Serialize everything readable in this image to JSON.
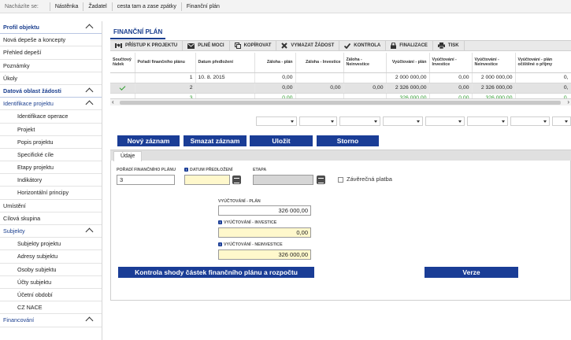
{
  "breadcrumb": {
    "label": "Nacházíte se:",
    "items": [
      "Nástěnka",
      "Žadatel",
      "cesta tam a zase zpátky",
      "Finanční plán"
    ]
  },
  "sidebar": {
    "items": [
      {
        "label": "Profil objektu",
        "kind": "sec",
        "chev": "up"
      },
      {
        "label": "Nová depeše a koncepty",
        "kind": "item"
      },
      {
        "label": "Přehled depeší",
        "kind": "item"
      },
      {
        "label": "Poznámky",
        "kind": "item"
      },
      {
        "label": "Úkoly",
        "kind": "item"
      },
      {
        "label": "Datová oblast žádosti",
        "kind": "sec",
        "chev": "up"
      },
      {
        "label": "Identifikace projektu",
        "kind": "blue",
        "chev": "up"
      },
      {
        "label": "Identifikace operace",
        "kind": "sub"
      },
      {
        "label": "Projekt",
        "kind": "sub"
      },
      {
        "label": "Popis projektu",
        "kind": "sub"
      },
      {
        "label": "Specifické cíle",
        "kind": "sub"
      },
      {
        "label": "Etapy projektu",
        "kind": "sub"
      },
      {
        "label": "Indikátory",
        "kind": "sub"
      },
      {
        "label": "Horizontální principy",
        "kind": "sub"
      },
      {
        "label": "Umístění",
        "kind": "item"
      },
      {
        "label": "Cílová skupina",
        "kind": "item"
      },
      {
        "label": "Subjekty",
        "kind": "blue",
        "chev": "up"
      },
      {
        "label": "Subjekty projektu",
        "kind": "sub"
      },
      {
        "label": "Adresy subjektu",
        "kind": "sub"
      },
      {
        "label": "Osoby subjektu",
        "kind": "sub"
      },
      {
        "label": "Účty subjektu",
        "kind": "sub"
      },
      {
        "label": "Účetní období",
        "kind": "sub"
      },
      {
        "label": "CZ NACE",
        "kind": "sub"
      },
      {
        "label": "Financování",
        "kind": "blue",
        "chev": "up"
      }
    ]
  },
  "page": {
    "title": "FINANČNÍ PLÁN"
  },
  "toolbar": [
    {
      "label": "PŘÍSTUP K PROJEKTU",
      "icon": "handshake-icon"
    },
    {
      "label": "PLNÉ MOCI",
      "icon": "envelope-icon"
    },
    {
      "label": "KOPÍROVAT",
      "icon": "copy-icon"
    },
    {
      "label": "VYMAZAT ŽÁDOST",
      "icon": "close-x-icon"
    },
    {
      "label": "KONTROLA",
      "icon": "checkmark-icon"
    },
    {
      "label": "FINALIZACE",
      "icon": "lock-icon"
    },
    {
      "label": "TISK",
      "icon": "printer-icon"
    }
  ],
  "grid": {
    "columns": [
      "Součtový řádek",
      "Pořadí finančního plánu",
      "Datum předložení",
      "Záloha - plán",
      "Záloha - Investice",
      "Záloha - Neinvestice",
      "Vyúčtování - plán",
      "Vyúčtování - Investice",
      "Vyúčtování - Neinvestice",
      "Vyúčtování - plán očištěné o příjmy"
    ],
    "rows": [
      {
        "check": false,
        "order": "1",
        "date": "10. 8. 2015",
        "zaloha_plan": "0,00",
        "zaloha_inv": "",
        "zaloha_neinv": "",
        "vyuct_plan": "2 000 000,00",
        "vyuct_inv": "0,00",
        "vyuct_neinv": "2 000 000,00",
        "vyuct_ocist": "0,",
        "style": ""
      },
      {
        "check": true,
        "order": "2",
        "date": "",
        "zaloha_plan": "0,00",
        "zaloha_inv": "0,00",
        "zaloha_neinv": "0,00",
        "vyuct_plan": "2 326 000,00",
        "vyuct_inv": "0,00",
        "vyuct_neinv": "2 326 000,00",
        "vyuct_ocist": "0,",
        "style": "sel"
      },
      {
        "check": false,
        "order": "3",
        "date": "",
        "zaloha_plan": "0,00",
        "zaloha_inv": "",
        "zaloha_neinv": "",
        "vyuct_plan": "326 000,00",
        "vyuct_inv": "0,00",
        "vyuct_neinv": "326 000,00",
        "vyuct_ocist": "0,",
        "style": "green"
      }
    ]
  },
  "actions": {
    "new": "Nový záznam",
    "delete": "Smazat záznam",
    "save": "Uložit",
    "cancel": "Storno"
  },
  "detail": {
    "tab": "Údaje",
    "order_label": "POŘADÍ FINANČNÍHO PLÁNU",
    "order_value": "3",
    "date_label": "DATUM PŘEDLOŽENÍ",
    "date_value": "",
    "stage_label": "ETAPA",
    "stage_value": "",
    "final_label": "Závěrečná platba",
    "vp_label": "VYÚČTOVÁNÍ - PLÁN",
    "vp_value": "326 000,00",
    "vi_label": "VYÚČTOVÁNÍ - INVESTICE",
    "vi_value": "0,00",
    "vn_label": "VYÚČTOVÁNÍ - NEINVESTICE",
    "vn_value": "326 000,00",
    "check_button": "Kontrola shody částek finančního plánu a rozpočtu",
    "versions_button": "Verze"
  }
}
